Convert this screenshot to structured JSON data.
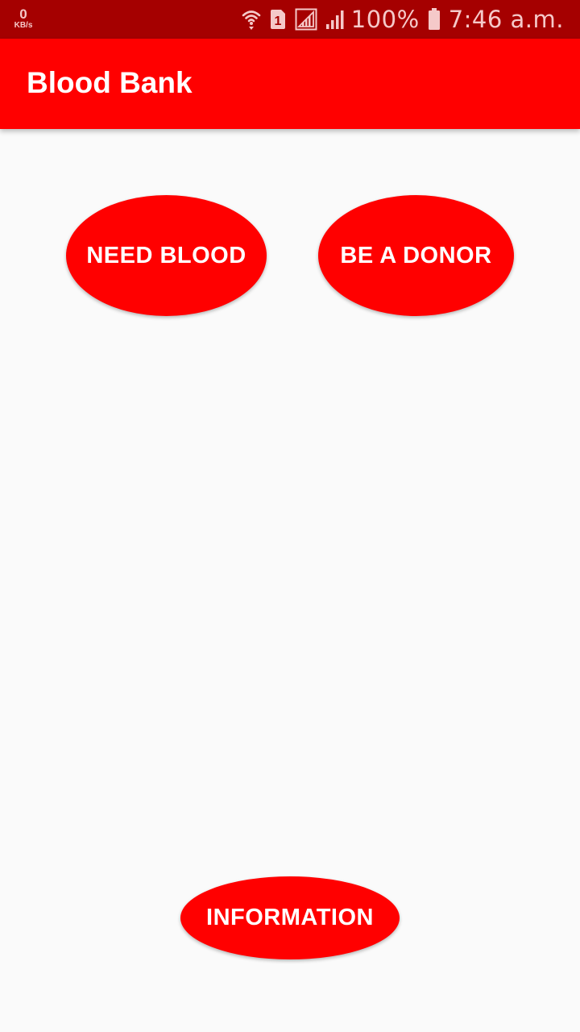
{
  "status_bar": {
    "net_speed_value": "0",
    "net_speed_unit": "KB/s",
    "sim_label": "1",
    "battery_percent": "100%",
    "time": "7:46 a.m.",
    "icons": [
      "wifi-icon",
      "sim-icon",
      "signal-outline-icon",
      "signal-icon",
      "battery-icon"
    ]
  },
  "app_bar": {
    "title": "Blood Bank"
  },
  "buttons": {
    "need_blood": "NEED BLOOD",
    "be_a_donor": "BE A DONOR",
    "information": "INFORMATION"
  },
  "colors": {
    "primary": "#FF0000",
    "status_bar": "#A50000",
    "background": "#FAFAFA",
    "button_text": "#FFFFFF"
  }
}
